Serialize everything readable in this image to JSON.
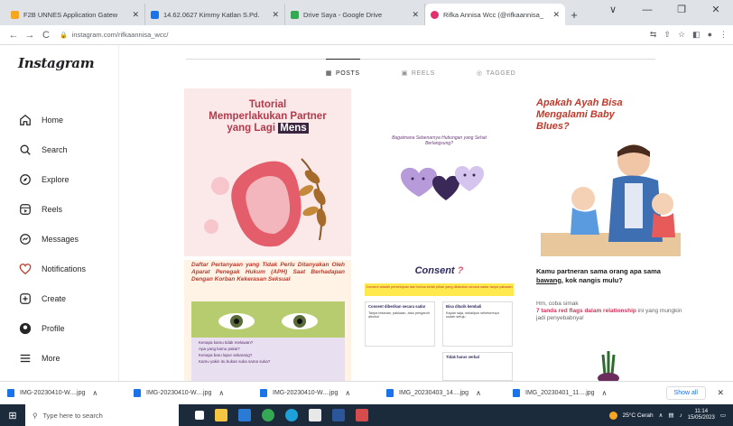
{
  "browser": {
    "tabs": [
      {
        "title": "F2B UNNES Application Gatew",
        "color": "#f5a623"
      },
      {
        "title": "14.62.0627 Kimmy Katlan S.Pd.",
        "color": "#1a73e8"
      },
      {
        "title": "Drive Saya - Google Drive",
        "color": "#34a853"
      },
      {
        "title": "Rifka Annisa Wcc (@rifkaannisa_",
        "color": "#e1306c"
      }
    ],
    "url": "instagram.com/rifkaannisa_wcc/",
    "window_controls": [
      "∨",
      "—",
      "❐",
      "✕"
    ]
  },
  "sidebar": {
    "logo": "Instagram",
    "items": [
      {
        "label": "Home",
        "icon": "home-icon"
      },
      {
        "label": "Search",
        "icon": "search-icon"
      },
      {
        "label": "Explore",
        "icon": "compass-icon"
      },
      {
        "label": "Reels",
        "icon": "reels-icon"
      },
      {
        "label": "Messages",
        "icon": "messenger-icon"
      },
      {
        "label": "Notifications",
        "icon": "heart-icon"
      },
      {
        "label": "Create",
        "icon": "plus-icon"
      },
      {
        "label": "Profile",
        "icon": "avatar-icon"
      },
      {
        "label": "More",
        "icon": "menu-icon"
      }
    ]
  },
  "profile_tabs": [
    {
      "label": "POSTS",
      "active": true
    },
    {
      "label": "REELS",
      "active": false
    },
    {
      "label": "TAGGED",
      "active": false
    }
  ],
  "posts": {
    "p1": {
      "line1": "Tutorial",
      "line2": "Memperlakukan Partner",
      "line3a": "yang Lagi",
      "line3b": "Mens"
    },
    "p2": {
      "caption": "Bagaimana Sebenarnya Hubungan yang Sehat Berlangsung?"
    },
    "p3": {
      "title": "Apakah Ayah Bisa Mengalami Baby Blues?"
    },
    "p4": {
      "heading": "Daftar Pertanyaan yang Tidak Perlu Ditanyakan Oleh Aparat Penegak Hukum (APH) Saat Berhadapan Dengan Korban Kekerasan Seksual",
      "items": [
        "Kenapa kamu tidak melawan?",
        "Apa yang kamu pakai?",
        "Kenapa baru lapor sekarang?",
        "Kamu yakin itu bukan suka sama suka?"
      ]
    },
    "p5": {
      "title": "Consent",
      "banner": "Consent adalah persetujuan dari kedua belah pihak yang dilakukan secara sadar tanpa paksaan",
      "box1_title": "Consent diberikan secara sadar",
      "box1_text": "Tanpa tekanan, paksaan, atau pengaruh alkohol",
      "box2_title": "Bisa ditarik kembali",
      "box2_text": "Kapan saja, sekalipun sebelumnya sudah setuju",
      "box3_title": "Tidak harus verbal"
    },
    "p6": {
      "q1": "Kamu partneran sama orang apa sama ",
      "q_u": "bawang",
      "q2": ", kok nangis mulu?",
      "b1": "Hm, coba simak",
      "b_red": "7 tanda red flags dalam relationship",
      "b2": " ini yang mungkin jadi penyebabnya!"
    }
  },
  "downloads": {
    "items": [
      "IMG-20230410-W....jpg",
      "IMG-20230410-W....jpg",
      "IMG-20230410-W....jpg",
      "IMG_20230403_14....jpg",
      "IMG_20230401_11....jpg"
    ],
    "show_all": "Show all"
  },
  "taskbar": {
    "search_placeholder": "Type here to search",
    "weather": "25°C Cerah",
    "time": "11:14",
    "date": "15/05/2023"
  }
}
